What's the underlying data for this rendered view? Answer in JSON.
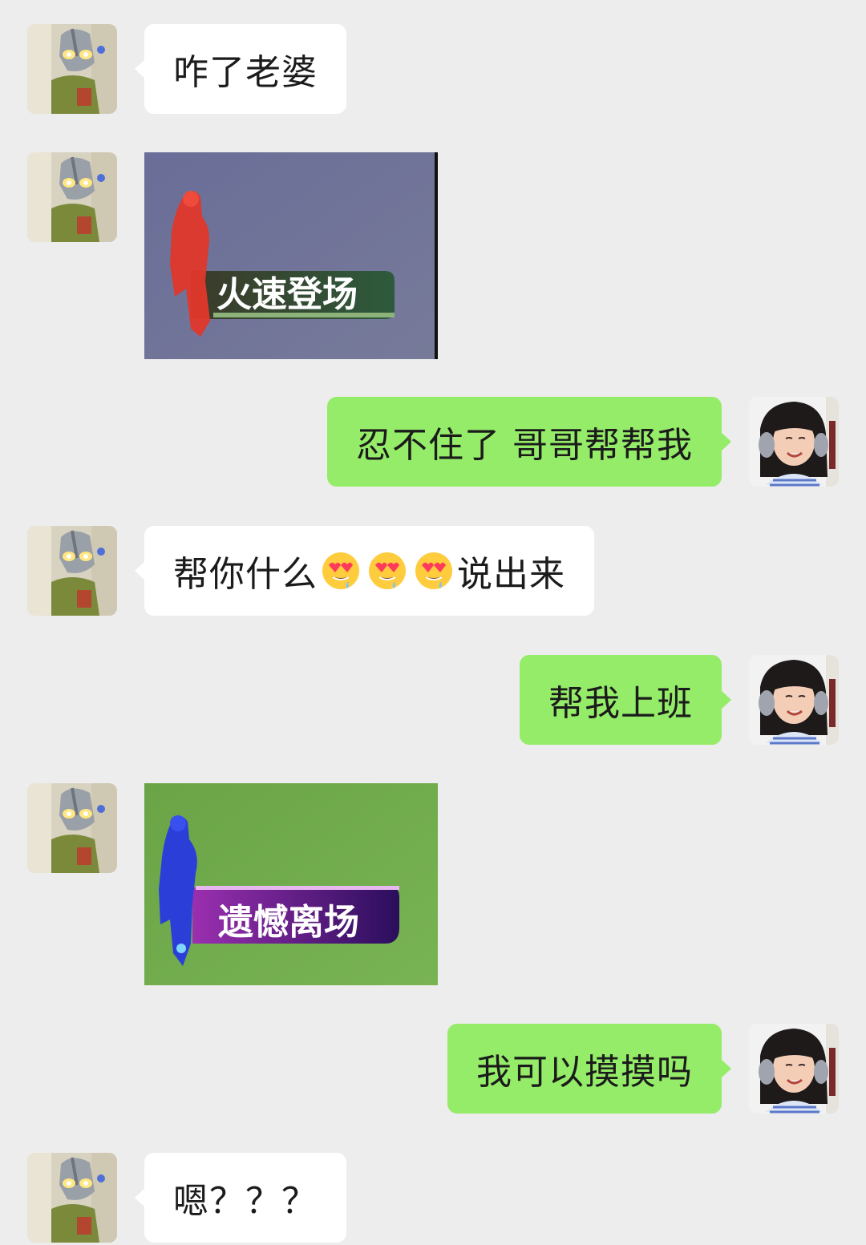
{
  "conversation": {
    "messages": [
      {
        "sender": "other",
        "type": "text",
        "text": "咋了老婆"
      },
      {
        "sender": "other",
        "type": "sticker",
        "caption": "火速登场"
      },
      {
        "sender": "me",
        "type": "text",
        "text": "忍不住了 哥哥帮帮我"
      },
      {
        "sender": "other",
        "type": "text",
        "text_before": "帮你什么",
        "emoji": "heart-eyes-drooling-emoji",
        "emoji_count": 3,
        "text_after": "说出来"
      },
      {
        "sender": "me",
        "type": "text",
        "text": "帮我上班"
      },
      {
        "sender": "other",
        "type": "sticker",
        "caption": "遗憾离场"
      },
      {
        "sender": "me",
        "type": "text",
        "text": "我可以摸摸吗"
      },
      {
        "sender": "other",
        "type": "text",
        "text": "嗯？？？"
      }
    ]
  },
  "colors": {
    "background": "#ededed",
    "incoming_bubble": "#ffffff",
    "outgoing_bubble": "#95ec69",
    "sticker1_bg": "#6c7096",
    "sticker1_banner": "#2f4a33",
    "sticker1_figure": "#e0372a",
    "sticker2_bg": "#6fa84a",
    "sticker2_banner": "#541a8a",
    "sticker2_figure": "#2b3fd8"
  }
}
